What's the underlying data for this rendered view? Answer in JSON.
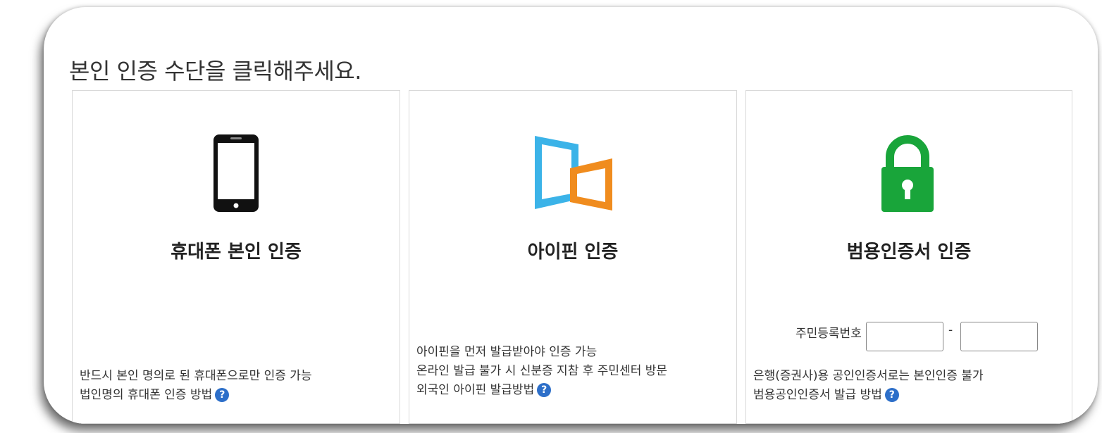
{
  "heading": "본인 인증 수단을 클릭해주세요.",
  "options": [
    {
      "title": "휴대폰 본인 인증",
      "icon": "smartphone-icon",
      "lines": [
        "반드시 본인 명의로 된 휴대폰으로만 인증 가능"
      ],
      "help_link": "법인명의 휴대폰 인증 방법"
    },
    {
      "title": "아이핀 인증",
      "icon": "ipin-icon",
      "lines": [
        "아이핀을 먼저 발급받아야 인증 가능",
        "온라인 발급 불가 시 신분증 지참 후 주민센터 방문"
      ],
      "help_link": "외국인 아이핀 발급방법"
    },
    {
      "title": "범용인증서 인증",
      "icon": "lock-icon",
      "rrn_label": "주민등록번호",
      "rrn_dash": "-",
      "lines": [
        "은행(증권사)용 공인인증서로는 본인인증 불가"
      ],
      "help_link": "범용공인인증서 발급 방법"
    }
  ],
  "help_icon_glyph": "?",
  "colors": {
    "ipin_blue": "#3bb3e8",
    "ipin_orange": "#f08c1e",
    "lock_green": "#19a53a",
    "help_blue": "#2d6fc9"
  }
}
